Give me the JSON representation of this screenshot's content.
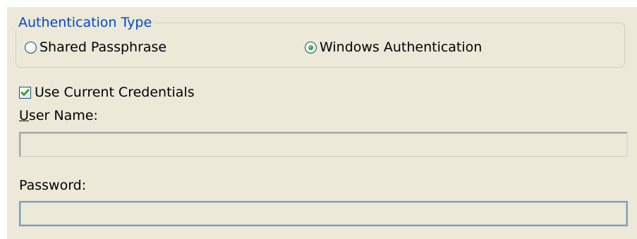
{
  "auth_group": {
    "legend": "Authentication Type",
    "options": [
      {
        "label": "Shared Passphrase",
        "checked": false
      },
      {
        "label": "Windows Authentication",
        "checked": true
      }
    ]
  },
  "credentials": {
    "use_current_label": "Use Current Credentials",
    "use_current_checked": true
  },
  "user_name": {
    "label_mnemonic": "U",
    "label_rest": "ser Name:",
    "value": ""
  },
  "password": {
    "label": "Password:",
    "value": ""
  },
  "colors": {
    "panel_bg": "#ece9d8",
    "legend_text": "#0046d5",
    "group_border": "#d0d0bf",
    "check_mark": "#21a121",
    "active_field_border": "#7f9db9"
  },
  "icons": {
    "radio_selected": "green-dot-radio-icon",
    "checkbox_checked": "green-checkmark-icon"
  }
}
